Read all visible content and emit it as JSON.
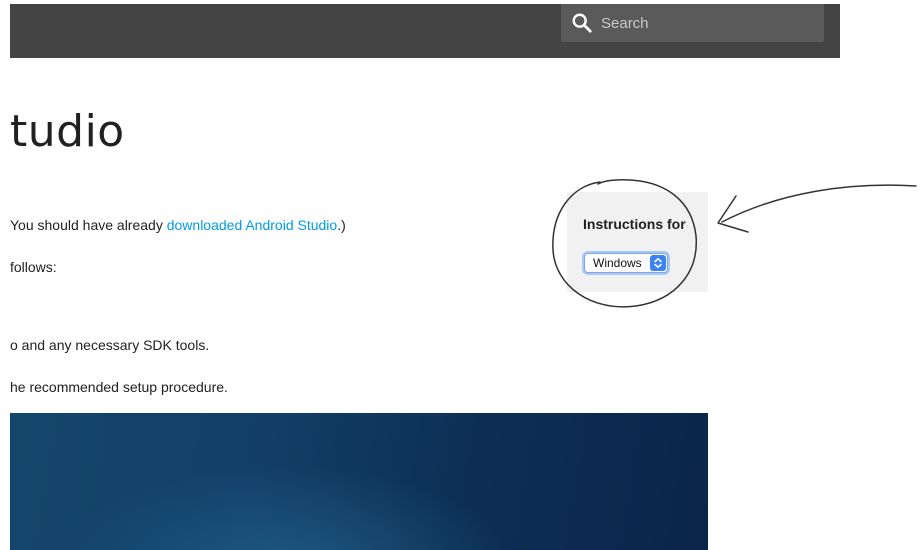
{
  "header": {
    "search": {
      "placeholder": "Search",
      "icon": "search-icon"
    }
  },
  "main": {
    "title": "tudio",
    "lines": {
      "line1_before": "You should have already ",
      "line1_link": "downloaded Android Studio",
      "line1_after": ".)",
      "line2": "follows:",
      "line3": "o and any necessary SDK tools.",
      "line4": "he recommended setup procedure."
    }
  },
  "sidebar": {
    "instructions_label": "Instructions for",
    "os_select": {
      "selected": "Windows"
    }
  },
  "colors": {
    "header_bg": "#444444",
    "link": "#039be5",
    "select_accent": "#3b82f6"
  }
}
